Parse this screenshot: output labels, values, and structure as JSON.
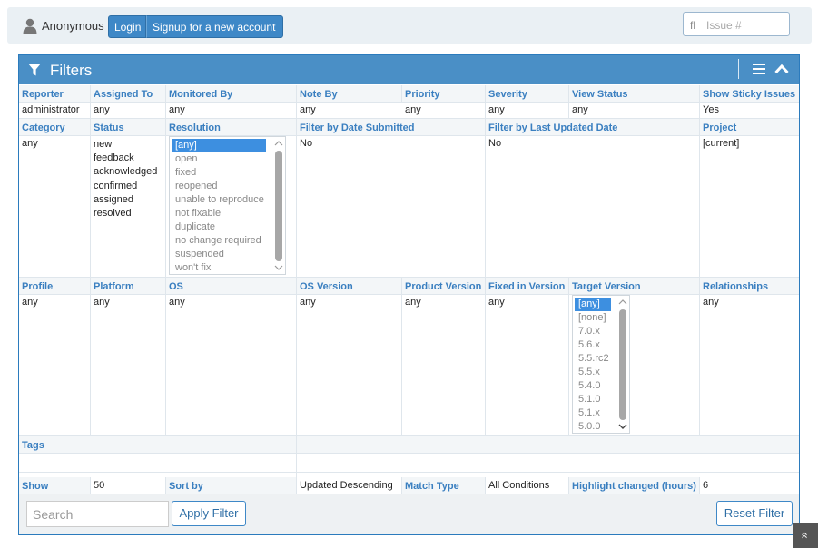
{
  "topbar": {
    "user_icon": "user-icon",
    "user_name": "Anonymous",
    "login_label": "Login",
    "signup_label": "Signup for a new account",
    "issue_prefix": "fl",
    "issue_placeholder": "Issue #"
  },
  "widget": {
    "title": "Filters",
    "icons": [
      "filter-icon",
      "menu-icon",
      "chevron-up-icon"
    ]
  },
  "filters": {
    "row1": {
      "reporter": {
        "label": "Reporter",
        "value": "administrator"
      },
      "assigned_to": {
        "label": "Assigned To",
        "value": "any"
      },
      "monitored_by": {
        "label": "Monitored By",
        "value": "any"
      },
      "note_by": {
        "label": "Note By",
        "value": "any"
      },
      "priority": {
        "label": "Priority",
        "value": "any"
      },
      "severity": {
        "label": "Severity",
        "value": "any"
      },
      "view_status": {
        "label": "View Status",
        "value": "any"
      },
      "sticky": {
        "label": "Show Sticky Issues",
        "value": "Yes"
      }
    },
    "row2": {
      "category": {
        "label": "Category",
        "value": "any"
      },
      "status": {
        "label": "Status",
        "values": [
          "new",
          "feedback",
          "acknowledged",
          "confirmed",
          "assigned",
          "resolved"
        ]
      },
      "resolution": {
        "label": "Resolution",
        "options": [
          "[any]",
          "open",
          "fixed",
          "reopened",
          "unable to reproduce",
          "not fixable",
          "duplicate",
          "no change required",
          "suspended",
          "won't fix"
        ],
        "selected": "[any]"
      },
      "date_submitted": {
        "label": "Filter by Date Submitted",
        "value": "No"
      },
      "last_updated": {
        "label": "Filter by Last Updated Date",
        "value": "No"
      },
      "project": {
        "label": "Project",
        "value": "[current]"
      }
    },
    "row3": {
      "profile": {
        "label": "Profile",
        "value": "any"
      },
      "platform": {
        "label": "Platform",
        "value": "any"
      },
      "os": {
        "label": "OS",
        "value": "any"
      },
      "os_version": {
        "label": "OS Version",
        "value": "any"
      },
      "product_version": {
        "label": "Product Version",
        "value": "any"
      },
      "fixed_in_version": {
        "label": "Fixed in Version",
        "value": "any"
      },
      "target_version": {
        "label": "Target Version",
        "options": [
          "[any]",
          "[none]",
          "7.0.x",
          "5.6.x",
          "5.5.rc2",
          "5.5.x",
          "5.4.0",
          "5.1.0",
          "5.1.x",
          "5.0.0"
        ],
        "selected": "[any]"
      },
      "relationships": {
        "label": "Relationships",
        "value": "any"
      }
    },
    "row4": {
      "tags": {
        "label": "Tags",
        "value": ""
      }
    },
    "row5": {
      "show": {
        "label": "Show",
        "value": "50"
      },
      "sort_by": {
        "label": "Sort by",
        "value": "Updated Descending"
      },
      "match_type": {
        "label": "Match Type",
        "value": "All Conditions"
      },
      "highlight": {
        "label": "Highlight changed (hours)",
        "value": "6"
      }
    }
  },
  "footer": {
    "search_placeholder": "Search",
    "apply_label": "Apply Filter",
    "reset_label": "Reset Filter",
    "scroll_top_icon": "double-chevron-up-icon",
    "scroll_top_glyph": "«"
  }
}
